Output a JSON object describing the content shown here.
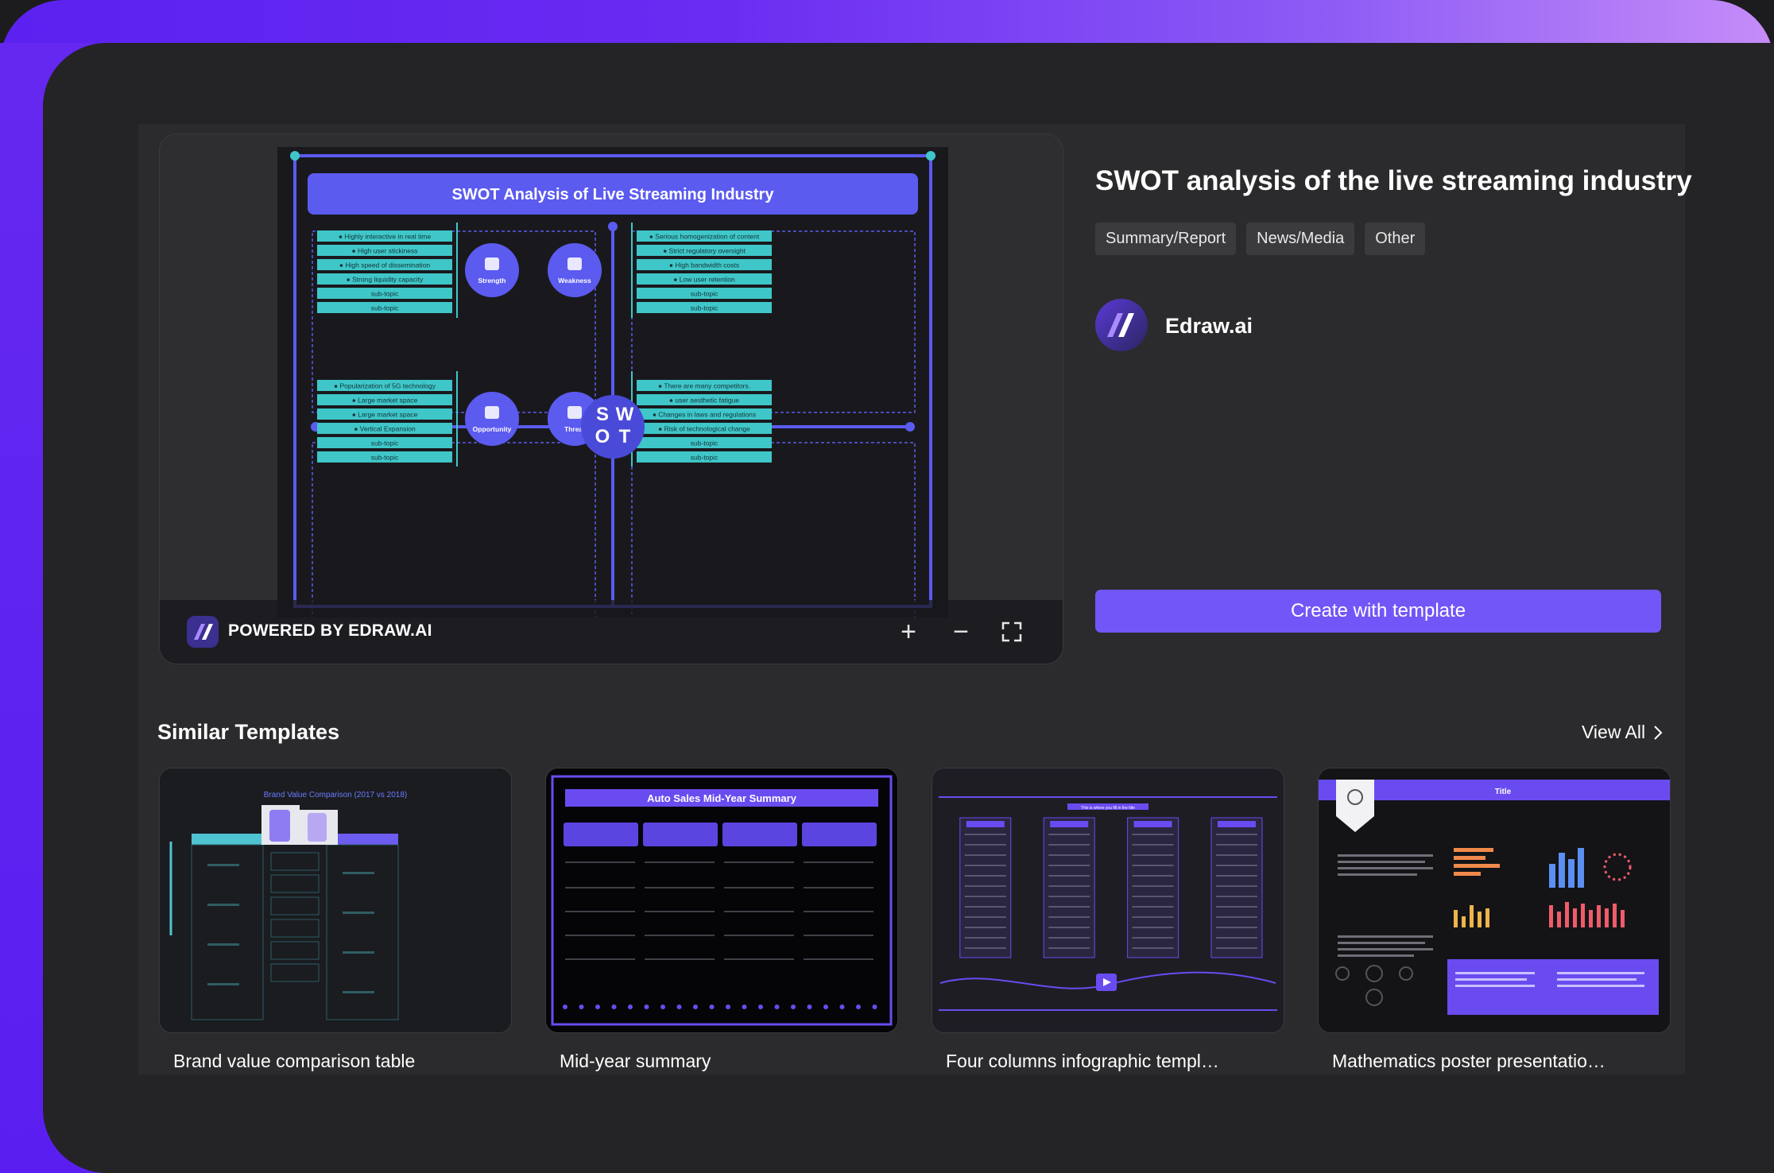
{
  "preview": {
    "diagram_title": "SWOT Analysis of Live Streaming Industry",
    "strength": {
      "label": "Strength",
      "items": [
        "Highly interactive in real time",
        "High user stickiness",
        "High speed of dissemination",
        "Strong liquidity capacity",
        "sub-topic",
        "sub-topic"
      ]
    },
    "weakness": {
      "label": "Weakness",
      "items": [
        "Serious homogenization of content",
        "Strict regulatory oversight",
        "High bandwidth costs",
        "Low user retention",
        "sub-topic",
        "sub-topic"
      ]
    },
    "opportunity": {
      "label": "Opportunity",
      "items": [
        "Popularization of 5G technology",
        "Large market space",
        "Large market space",
        "Vertical Expansion",
        "sub-topic",
        "sub-topic"
      ]
    },
    "threat": {
      "label": "Threat",
      "items": [
        "There are many competitors.",
        "user aesthetic fatigue",
        "Changes in laws and regulations",
        "Risk of technological change",
        "sub-topic",
        "sub-topic"
      ]
    },
    "letters": [
      "S",
      "W",
      "O",
      "T"
    ],
    "powered_by": "POWERED BY EDRAW.AI",
    "zoom_in_icon": "plus-icon",
    "zoom_out_icon": "minus-icon",
    "fullscreen_icon": "fullscreen-icon"
  },
  "details": {
    "title": "SWOT analysis of the live streaming industry",
    "tags": [
      "Summary/Report",
      "News/Media",
      "Other"
    ],
    "author": "Edraw.ai",
    "create_button": "Create with template"
  },
  "similar": {
    "heading": "Similar Templates",
    "view_all": "View All",
    "items": [
      {
        "label": "Brand value comparison table",
        "thumb_title": "Brand Value Comparison (2017 vs 2018)"
      },
      {
        "label": "Mid-year summary",
        "thumb_title": "Auto Sales Mid-Year Summary"
      },
      {
        "label": "Four columns infographic templ…",
        "thumb_title": "This is where you fill in the title"
      },
      {
        "label": "Mathematics poster presentatio…",
        "thumb_title": "Title"
      }
    ]
  },
  "colors": {
    "accent": "#7356f7",
    "frame_gradient_start": "#5b21f0",
    "frame_gradient_end": "#c58cf8",
    "teal": "#3fc6c8",
    "diagram_purple": "#5b5bf0"
  }
}
